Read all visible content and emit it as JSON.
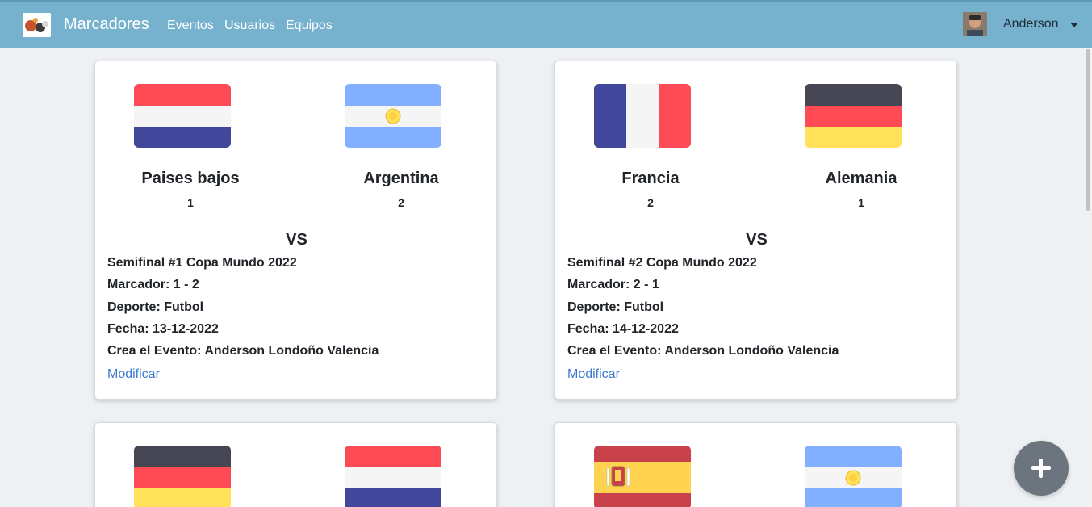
{
  "navbar": {
    "brand": "Marcadores",
    "links": [
      "Eventos",
      "Usuarios",
      "Equipos"
    ],
    "user": "Anderson"
  },
  "cards": [
    {
      "home_team": "Paises bajos",
      "home_score": "1",
      "away_team": "Argentina",
      "away_score": "2",
      "vs": "VS",
      "title": "Semifinal #1 Copa Mundo 2022",
      "marcador": "Marcador: 1 - 2",
      "deporte": "Deporte: Futbol",
      "fecha": "Fecha: 13-12-2022",
      "creador": "Crea el Evento: Anderson Londoño Valencia",
      "modify": "Modificar"
    },
    {
      "home_team": "Francia",
      "home_score": "2",
      "away_team": "Alemania",
      "away_score": "1",
      "vs": "VS",
      "title": "Semifinal #2 Copa Mundo 2022",
      "marcador": "Marcador: 2 - 1",
      "deporte": "Deporte: Futbol",
      "fecha": "Fecha: 14-12-2022",
      "creador": "Crea el Evento: Anderson Londoño Valencia",
      "modify": "Modificar"
    }
  ],
  "colors": {
    "navbar": "#76b1ce",
    "link": "#3b7ad0",
    "fab": "#6c757d"
  },
  "icons": [
    "logo-icon",
    "avatar-icon",
    "caret-down-icon",
    "add-icon"
  ]
}
